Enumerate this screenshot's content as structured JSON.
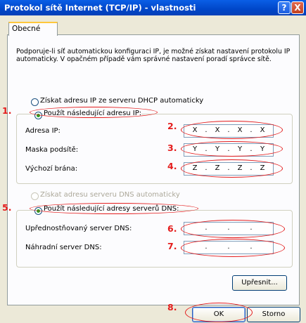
{
  "window": {
    "title": "Protokol sítě Internet (TCP/IP) - vlastnosti",
    "help_glyph": "?",
    "close_glyph": "X"
  },
  "tab": {
    "label": "Obecné"
  },
  "intro": "Podporuje-li síť automatickou konfiguraci IP, je možné získat nastavení protokolu IP automaticky. V opačném případě vám správné nastavení poradí správce sítě.",
  "ip": {
    "auto_label": "Získat adresu IP ze serveru DHCP automaticky",
    "manual_label": "Použít následující adresu IP:",
    "address_label": "Adresa IP:",
    "mask_label": "Maska podsítě:",
    "gateway_label": "Výchozí brána:",
    "address": [
      "X",
      "X",
      "X",
      "X"
    ],
    "mask": [
      "Y",
      "Y",
      "Y",
      "Y"
    ],
    "gateway": [
      "Z",
      "Z",
      "Z",
      "Z"
    ]
  },
  "dns": {
    "auto_label": "Získat adresu serveru DNS automaticky",
    "manual_label": "Použít následující adresy serverů DNS:",
    "preferred_label": "Upřednostňovaný server DNS:",
    "alternate_label": "Náhradní server DNS:",
    "preferred": [
      "",
      "",
      "",
      ""
    ],
    "alternate": [
      "",
      "",
      "",
      ""
    ]
  },
  "buttons": {
    "advanced": "Upřesnit...",
    "ok": "OK",
    "cancel": "Storno"
  },
  "annotations": [
    "1.",
    "2.",
    "3.",
    "4.",
    "5.",
    "6.",
    "7.",
    "8."
  ],
  "colors": {
    "annotation": "#e41c1c",
    "titlebar": "#0a5fe6",
    "radio_selected": "#21a121"
  }
}
